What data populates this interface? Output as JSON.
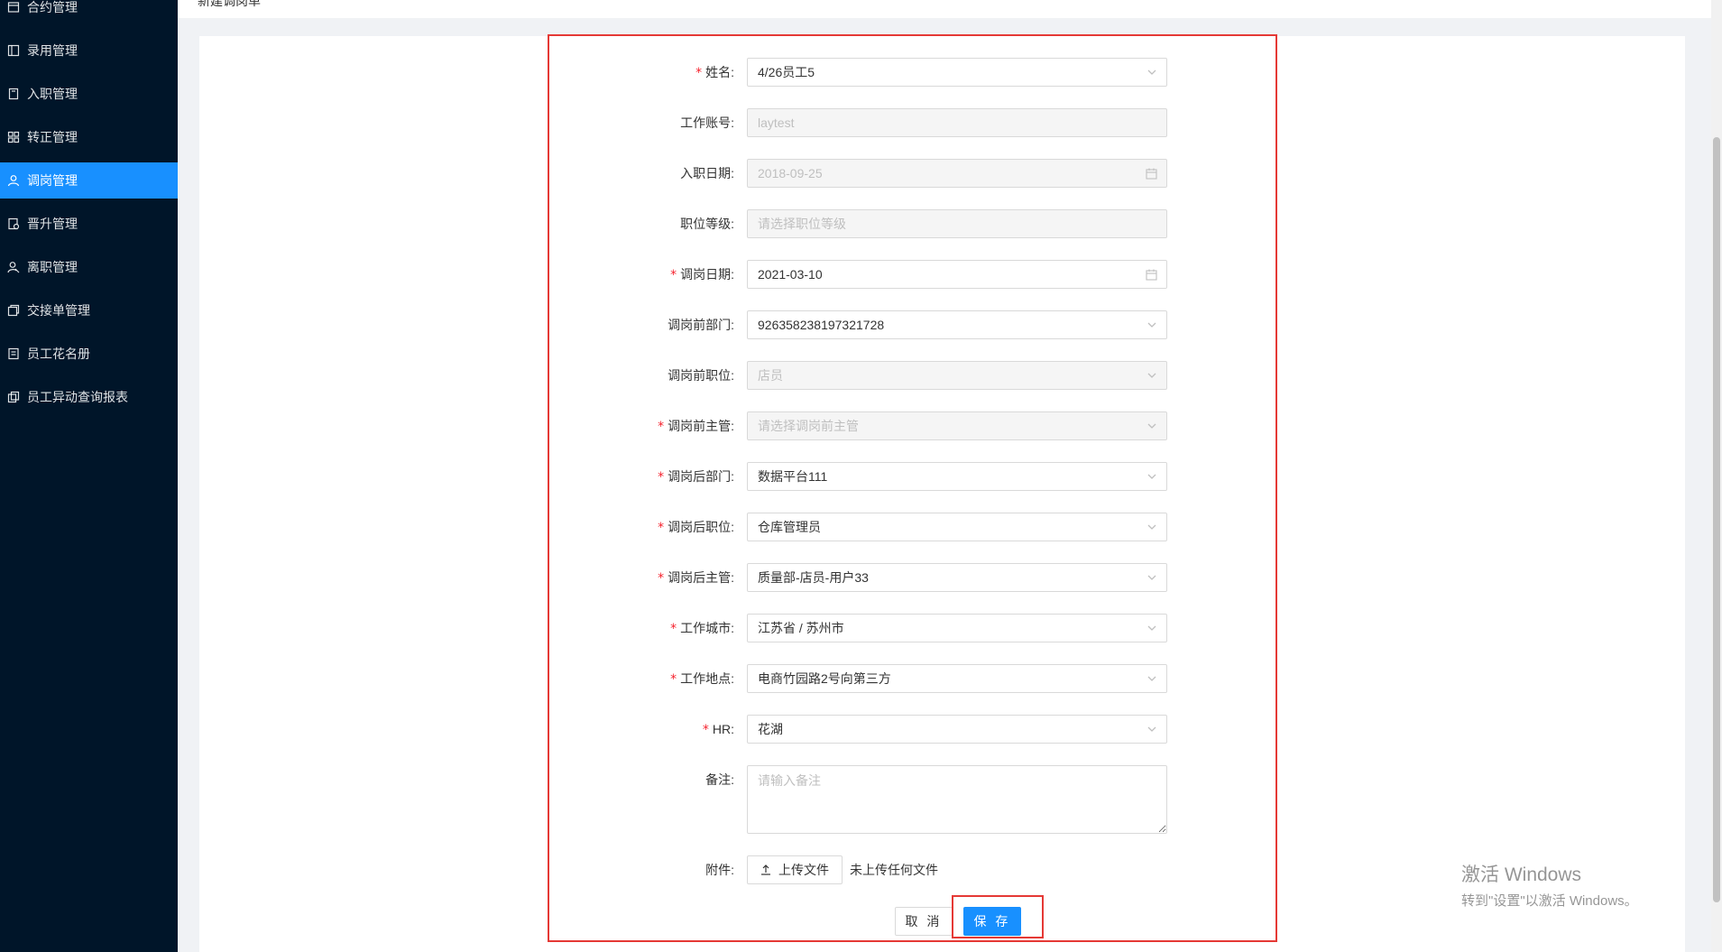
{
  "page": {
    "breadcrumb": "新建调岗单"
  },
  "sidebar": {
    "items": [
      {
        "label": "合约管理",
        "icon": "contract-icon",
        "active": false
      },
      {
        "label": "录用管理",
        "icon": "hire-icon",
        "active": false
      },
      {
        "label": "入职管理",
        "icon": "onboard-icon",
        "active": false
      },
      {
        "label": "转正管理",
        "icon": "regularize-icon",
        "active": false
      },
      {
        "label": "调岗管理",
        "icon": "transfer-icon",
        "active": true
      },
      {
        "label": "晋升管理",
        "icon": "promotion-icon",
        "active": false
      },
      {
        "label": "离职管理",
        "icon": "resign-icon",
        "active": false
      },
      {
        "label": "交接单管理",
        "icon": "handover-icon",
        "active": false
      },
      {
        "label": "员工花名册",
        "icon": "roster-icon",
        "active": false
      },
      {
        "label": "员工异动查询报表",
        "icon": "report-icon",
        "active": false
      }
    ]
  },
  "form": {
    "name": {
      "label": "姓名:",
      "value": "4/26员工5"
    },
    "account": {
      "label": "工作账号:",
      "value": "laytest"
    },
    "entry_date": {
      "label": "入职日期:",
      "value": "2018-09-25"
    },
    "level": {
      "label": "职位等级:",
      "placeholder": "请选择职位等级"
    },
    "transfer_date": {
      "label": "调岗日期:",
      "value": "2021-03-10"
    },
    "dept_before": {
      "label": "调岗前部门:",
      "value": "926358238197321728"
    },
    "pos_before": {
      "label": "调岗前职位:",
      "value": "店员"
    },
    "mgr_before": {
      "label": "调岗前主管:",
      "placeholder": "请选择调岗前主管"
    },
    "dept_after": {
      "label": "调岗后部门:",
      "value": "数据平台111"
    },
    "pos_after": {
      "label": "调岗后职位:",
      "value": "仓库管理员"
    },
    "mgr_after": {
      "label": "调岗后主管:",
      "value": "质量部-店员-用户33"
    },
    "city": {
      "label": "工作城市:",
      "value": "江苏省 / 苏州市"
    },
    "location": {
      "label": "工作地点:",
      "value": "电商竹园路2号向第三方"
    },
    "hr": {
      "label": "HR:",
      "value": "花湖"
    },
    "remark": {
      "label": "备注:",
      "placeholder": "请输入备注"
    },
    "attachment": {
      "label": "附件:",
      "button": "上传文件",
      "hint": "未上传任何文件"
    },
    "required_mark": "*"
  },
  "actions": {
    "cancel": "取 消",
    "save": "保 存"
  },
  "watermark": {
    "line1": "激活 Windows",
    "line2": "转到\"设置\"以激活 Windows。"
  },
  "colors": {
    "sidebar_bg": "#001529",
    "accent": "#1890ff",
    "required": "#f5222d",
    "highlight": "#e53935"
  }
}
